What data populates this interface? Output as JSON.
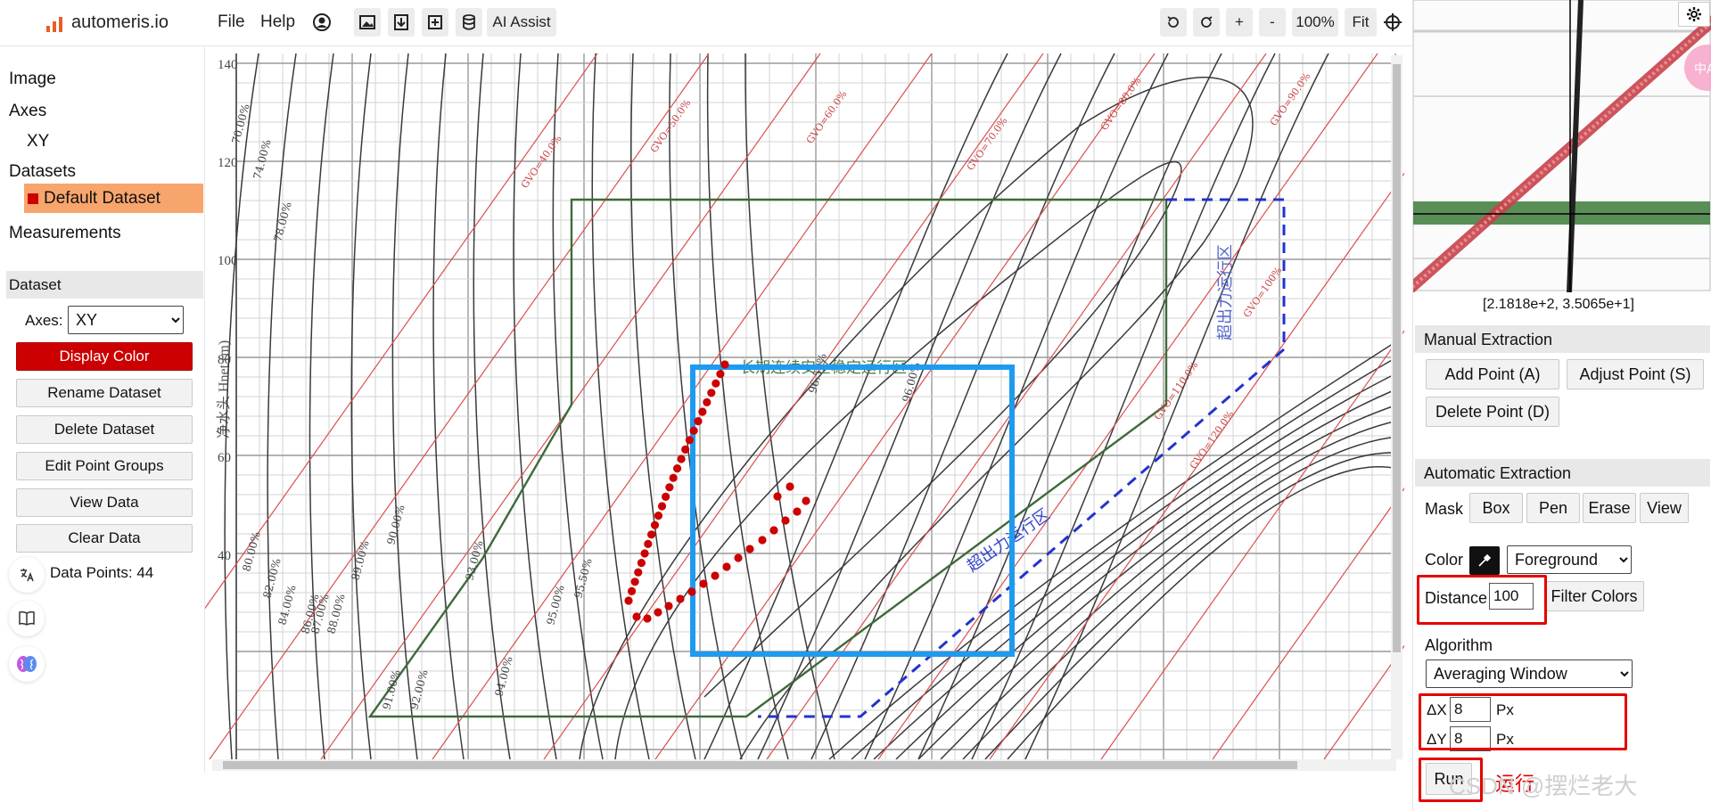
{
  "header": {
    "brand": "automeris.io",
    "menus": [
      "File",
      "Help"
    ],
    "ai_assist": "AI Assist",
    "zoom_in": "+",
    "zoom_out": "-",
    "zoom_level": "100%",
    "fit": "Fit"
  },
  "sidebar": {
    "tree": {
      "image": "Image",
      "axes": "Axes",
      "axes_child": "XY",
      "datasets": "Datasets",
      "dataset_item": "Default Dataset",
      "measurements": "Measurements"
    },
    "dataset_panel": {
      "title": "Dataset",
      "axes_label": "Axes:",
      "axes_value": "XY",
      "buttons": {
        "display_color": "Display Color",
        "rename": "Rename Dataset",
        "delete": "Delete Dataset",
        "edit_groups": "Edit Point Groups",
        "view_data": "View Data",
        "clear_data": "Clear Data"
      },
      "data_points": "Data Points: 44"
    }
  },
  "right_panel": {
    "coords": "[2.1818e+2, 3.5065e+1]",
    "manual": {
      "title": "Manual Extraction",
      "add_point": "Add Point (A)",
      "adjust_point": "Adjust Point (S)",
      "delete_point": "Delete Point (D)"
    },
    "automatic": {
      "title": "Automatic Extraction",
      "mask_label": "Mask",
      "mask_tools": [
        "Box",
        "Pen",
        "Erase",
        "View"
      ],
      "color_label": "Color",
      "color_mode": "Foreground",
      "distance_label": "Distance",
      "distance_value": "100",
      "filter_colors": "Filter Colors",
      "algorithm_label": "Algorithm",
      "algorithm_value": "Averaging Window",
      "dx_label": "ΔX",
      "dx_value": "8",
      "dy_label": "ΔY",
      "dy_value": "8",
      "px_unit": "Px",
      "run": "Run",
      "run_annotation": "运行",
      "watermark": "CSDN @摆烂老大"
    }
  },
  "plot": {
    "y_ticks": [
      "140",
      "120",
      "100",
      "80",
      "60",
      "40"
    ],
    "y_axis_label": "净水头 Hnet (m)",
    "zone_stable": "长期连续安全稳定运行区",
    "zone_overload_1": "超出力运行区",
    "zone_overload_2": "超出力运行区",
    "gvo_labels": [
      "GVO=40.0%",
      "GVO=50.0%",
      "GVO=60.0%",
      "GVO=70.0%",
      "GVO=80.0%",
      "GVO=90.0%",
      "GVO=100%",
      "GVO=110.0%",
      "GVO=120.0%"
    ],
    "efficiency_labels": [
      "70.00%",
      "74.00%",
      "78.00%",
      "80.00%",
      "82.00%",
      "84.00%",
      "86.00%",
      "87.00%",
      "88.00%",
      "89.00%",
      "90.00%",
      "91.00%",
      "92.00%",
      "93.00%",
      "94.00%",
      "95.00%",
      "95.50%",
      "96.00%",
      "96.50%"
    ],
    "colors": {
      "dataset": "#cc0000",
      "selection_box": "#1e9bf0",
      "green_zone": "#3d6b3a",
      "blue_dashed": "#2233cc",
      "gvo_lines": "#d95050"
    }
  }
}
